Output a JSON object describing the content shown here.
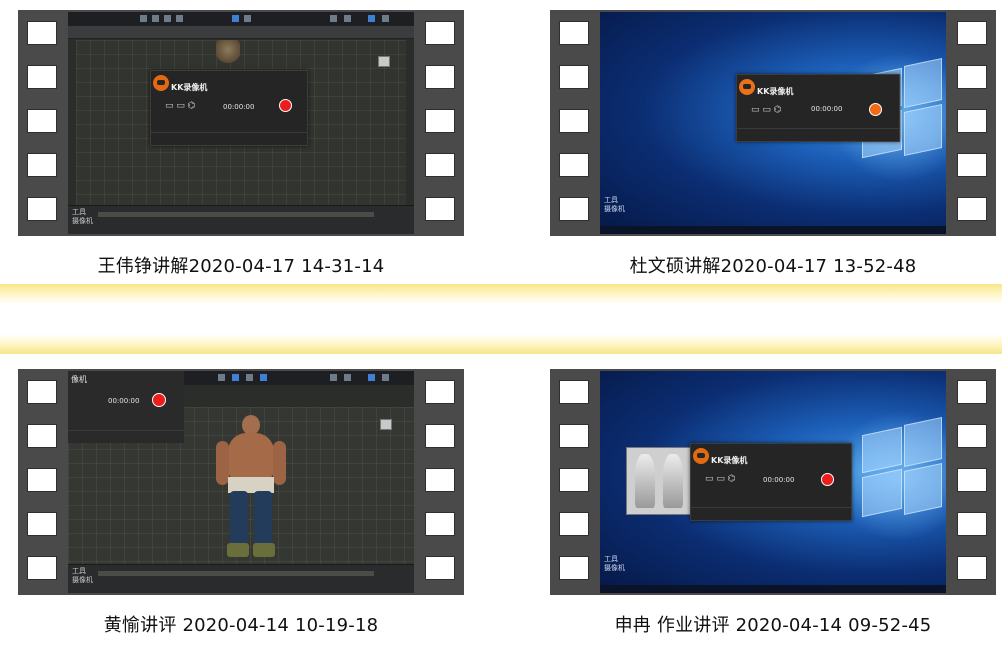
{
  "videos": [
    {
      "title": "王伟铮讲解2020-04-17 14-31-14",
      "screen": "3d-software"
    },
    {
      "title": "杜文硕讲解2020-04-17 13-52-48",
      "screen": "windows-desktop"
    },
    {
      "title": "黄愉讲评 2020-04-14 10-19-18",
      "screen": "3d-software-character"
    },
    {
      "title": "申冉 作业讲评 2020-04-14 09-52-45",
      "screen": "windows-desktop-thumbnails"
    }
  ],
  "screen_text": {
    "recorder_name": "KK录像机",
    "panel_tools": "工具",
    "panel_camera": "摄像机",
    "camera_heading": "像机",
    "recorder_timer": "00:00:00"
  },
  "colors": {
    "film": "#4a4a4a",
    "band": "#f7e58a",
    "record_button": "#ee1d1d",
    "recorder_logo": "#e46a12",
    "desktop_blue": "#1c5fb8"
  },
  "icons": [
    "film-perforation",
    "record-button",
    "kk-recorder-logo",
    "windows-logo"
  ]
}
